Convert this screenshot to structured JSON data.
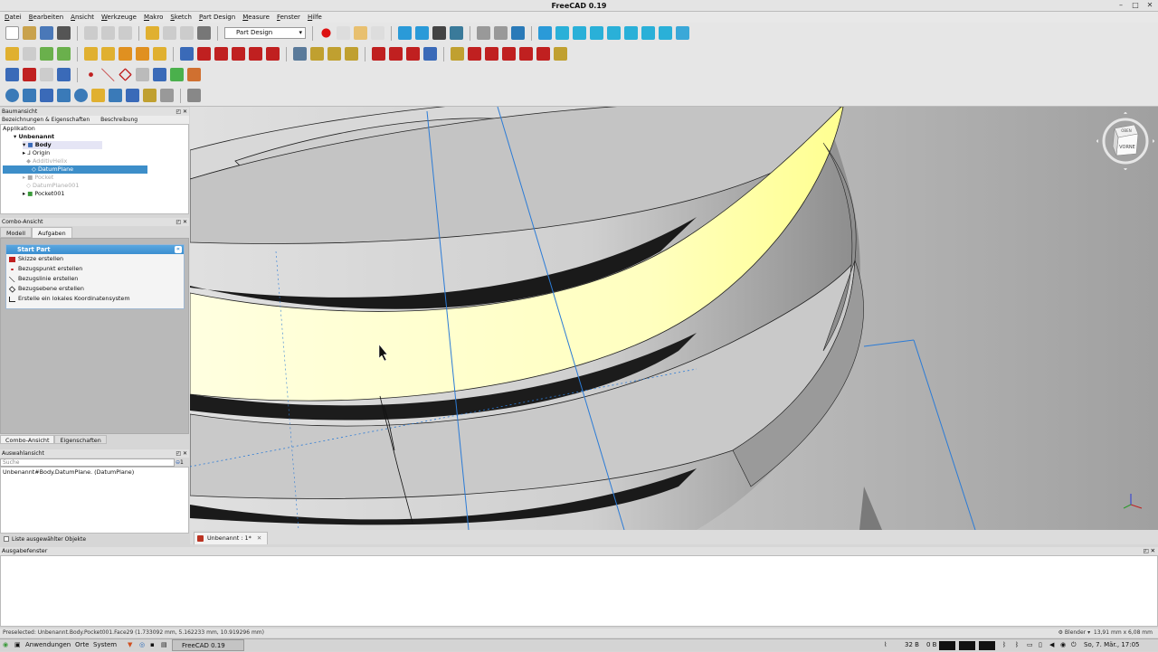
{
  "window": {
    "title": "FreeCAD 0.19"
  },
  "menu": [
    "Datei",
    "Bearbeiten",
    "Ansicht",
    "Werkzeuge",
    "Makro",
    "Sketch",
    "Part Design",
    "Measure",
    "Fenster",
    "Hilfe"
  ],
  "toolbar": {
    "workbench": "Part Design"
  },
  "tree_panel": {
    "title": "Baumansicht",
    "tabs": [
      "Bezeichnungen & Eigenschaften",
      "Beschreibung"
    ],
    "root_label": "Applikation",
    "items": [
      {
        "label": "Unbenannt"
      },
      {
        "label": "Body"
      },
      {
        "label": "Origin"
      },
      {
        "label": "AdditivHelix"
      },
      {
        "label": "DatumPlane"
      },
      {
        "label": "Pocket"
      },
      {
        "label": "DatumPlane001"
      },
      {
        "label": "Pocket001"
      }
    ]
  },
  "combo": {
    "title": "Combo-Ansicht",
    "tabs": [
      "Modell",
      "Aufgaben"
    ],
    "task_title": "Start Part",
    "tasks": [
      "Skizze erstellen",
      "Bezugspunkt erstellen",
      "Bezugslinie erstellen",
      "Bezugsebene erstellen",
      "Erstelle ein lokales Koordinatensystem"
    ],
    "bottom_tabs": [
      "Combo-Ansicht",
      "Eigenschaften"
    ]
  },
  "selection": {
    "title": "Auswahlansicht",
    "search_placeholder": "Suche",
    "search_count": "1",
    "entry": "Unbenannt#Body.DatumPlane. (DatumPlane)",
    "checkbox_label": "Liste ausgewählter Objekte"
  },
  "navcube": {
    "top": "OBEN",
    "front": "VORNE"
  },
  "document_tab": "Unbenannt : 1*",
  "report": {
    "title": "Ausgabefenster"
  },
  "status": {
    "preselected": "Preselected: Unbenannt.Body.Pocket001.Face29 (1.733092 mm, 5.162233 mm, 10.919296 mm)",
    "nav": "Blender",
    "dims": "13,91 mm x 6,08 mm"
  },
  "taskbar": {
    "apps": "Anwendungen",
    "places": "Orte",
    "system": "System",
    "window": "FreeCAD 0.19",
    "net": "32 B",
    "net2": "0 B",
    "clock": "So, 7. Mär., 17:05"
  },
  "colors": {
    "selection": "#3d8ec9",
    "highlight": "#ffffc8",
    "task_header": "#3a8ed0"
  }
}
